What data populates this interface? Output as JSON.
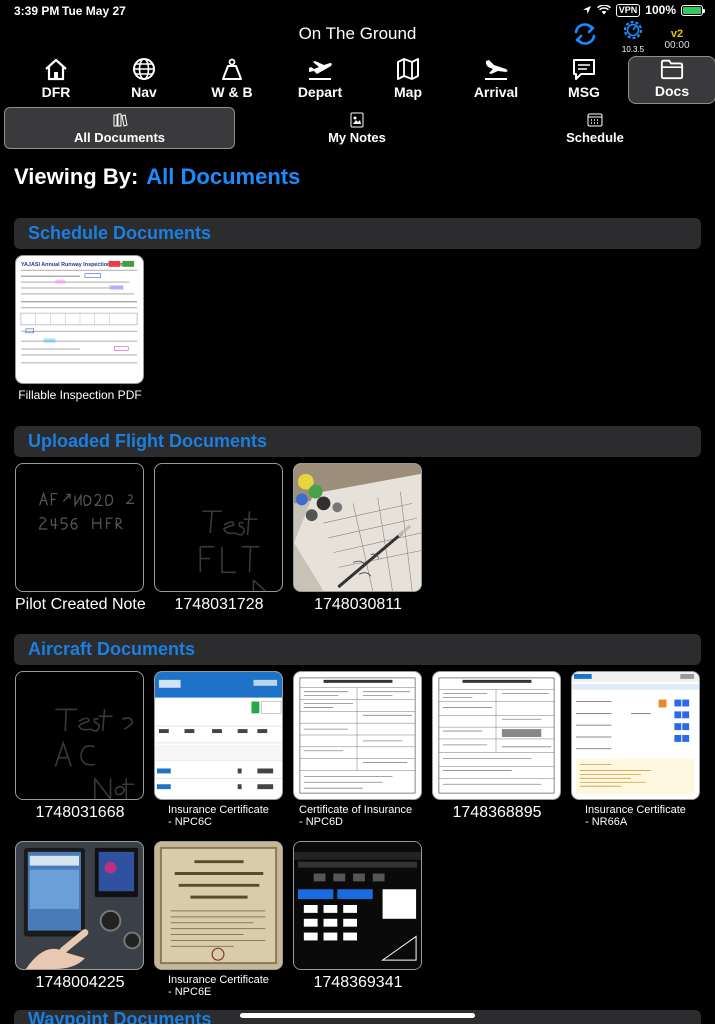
{
  "status_bar": {
    "time": "3:39 PM",
    "date": "Tue May 27",
    "vpn": "VPN",
    "battery": "100%"
  },
  "header": {
    "title": "On The Ground",
    "version": "10.3.5",
    "badge": "v2",
    "timer": "00:00"
  },
  "nav": {
    "dfr": "DFR",
    "nav": "Nav",
    "wb": "W & B",
    "depart": "Depart",
    "map": "Map",
    "arrival": "Arrival",
    "msg": "MSG",
    "docs": "Docs"
  },
  "subtabs": {
    "all": "All Documents",
    "notes": "My Notes",
    "schedule": "Schedule"
  },
  "viewing": {
    "label": "Viewing By:",
    "value": "All Documents"
  },
  "sections": {
    "schedule": {
      "title": "Schedule Documents",
      "items": [
        {
          "label": "Fillable Inspection PDF",
          "form_title": "YAJASI Annual Runway Inspection Form"
        }
      ]
    },
    "uploaded": {
      "title": "Uploaded Flight Documents",
      "items": [
        {
          "label": "Pilot Created Note"
        },
        {
          "label": "1748031728"
        },
        {
          "label": "1748030811"
        }
      ]
    },
    "aircraft": {
      "title": "Aircraft Documents",
      "items": [
        {
          "label": "1748031668"
        },
        {
          "label": "Insurance Certificate\n- NPC6C"
        },
        {
          "label": "Certificate of Insurance\n- NPC6D"
        },
        {
          "label": "1748368895"
        },
        {
          "label": "Insurance Certificate\n- NR66A"
        },
        {
          "label": "1748004225"
        },
        {
          "label": "Insurance Certificate\n- NPC6E"
        },
        {
          "label": "1748369341"
        }
      ]
    },
    "waypoint": {
      "title": "Waypoint Documents"
    }
  },
  "icons": [
    "house-icon",
    "globe-icon",
    "weight-icon",
    "plane-departure-icon",
    "map-icon",
    "plane-arrival-icon",
    "message-icon",
    "folder-icon",
    "sync-icon",
    "gear-icon",
    "location-icon",
    "wifi-icon"
  ],
  "colors": {
    "accent": "#1a8cff",
    "section_text": "#1a7fe0",
    "section_bg": "#2c2c2e",
    "active_tab": "#3a3a3c",
    "sync": "#1a8cff",
    "badge": "#e6c200"
  }
}
